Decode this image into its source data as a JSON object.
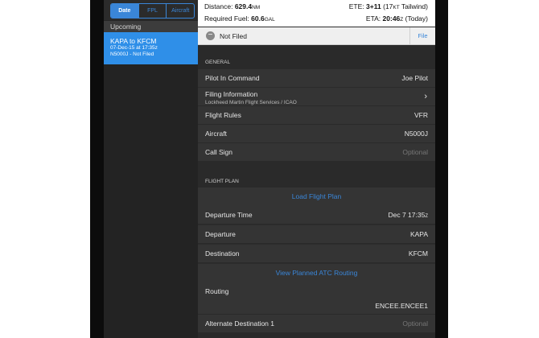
{
  "sidebar": {
    "segments": [
      "Date",
      "FPL",
      "Aircraft"
    ],
    "section_header": "Upcoming",
    "flight": {
      "route": "KAPA to KFCM",
      "datetime": "07-Dec-15 at 17:35z",
      "status_line": "N5000J - Not Filed"
    }
  },
  "summary": {
    "distance_label": "Distance:",
    "distance_value": "629.4",
    "distance_unit": "NM",
    "ete_label": "ETE:",
    "ete_value": "3+11",
    "ete_wind_paren_open": "(17",
    "ete_wind_unit": "KT",
    "ete_wind_text": " Tailwind)",
    "fuel_label": "Required Fuel:",
    "fuel_value": "60.6",
    "fuel_unit": "GAL",
    "eta_label": "ETA:",
    "eta_value": "20:46",
    "eta_zulu": "Z",
    "eta_note": " (Today)"
  },
  "status": {
    "text": "Not Filed",
    "file_button": "File"
  },
  "general": {
    "header": "GENERAL",
    "rows": [
      {
        "label": "Pilot In Command",
        "value": "Joe Pilot"
      },
      {
        "label": "Filing Information",
        "sub": "Lockheed Martin Flight Services / ICAO"
      },
      {
        "label": "Flight Rules",
        "value": "VFR"
      },
      {
        "label": "Aircraft",
        "value": "N5000J"
      },
      {
        "label": "Call Sign",
        "placeholder": "Optional"
      }
    ]
  },
  "flight_plan": {
    "header": "FLIGHT PLAN",
    "load_link": "Load Flight Plan",
    "departure_time_label": "Departure Time",
    "departure_time_value": "Dec 7  17:35",
    "departure_time_zulu": "Z",
    "departure_label": "Departure",
    "departure_value": "KAPA",
    "destination_label": "Destination",
    "destination_value": "KFCM",
    "atc_link": "View Planned ATC Routing",
    "routing_label": "Routing",
    "routing_value": "ENCEE.ENCEE1",
    "alternate_label": "Alternate Destination 1",
    "alternate_placeholder": "Optional"
  },
  "colors": {
    "accent": "#3a86d8",
    "selected_item": "#2f8fe8",
    "row_bg": "#343434"
  },
  "icons": {
    "status": "minus-circle-icon",
    "filing_chevron": "chevron-right-icon"
  }
}
